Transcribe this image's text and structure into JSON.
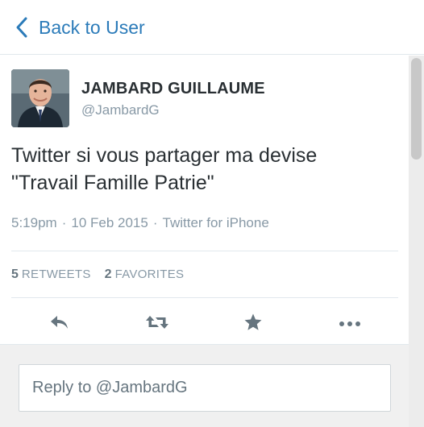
{
  "nav": {
    "back_label": "Back to User"
  },
  "tweet": {
    "author_name": "JAMBARD GUILLAUME",
    "author_handle": "@JambardG",
    "text_line1": "Twitter si vous partager ma devise",
    "text_line2": "\"Travail Famille Patrie\"",
    "time": "5:19pm",
    "date": "10 Feb 2015",
    "source": "Twitter for iPhone",
    "separator": "·",
    "retweets_count": "5",
    "retweets_label": "RETWEETS",
    "favorites_count": "2",
    "favorites_label": "FAVORITES"
  },
  "actions": {
    "icons": [
      "reply-icon",
      "retweet-icon",
      "favorite-star-icon",
      "more-icon"
    ]
  },
  "reply": {
    "placeholder": "Reply to @JambardG"
  },
  "colors": {
    "link": "#2b7bb9",
    "text": "#292f33",
    "muted": "#8899a6",
    "icon": "#66757f"
  }
}
